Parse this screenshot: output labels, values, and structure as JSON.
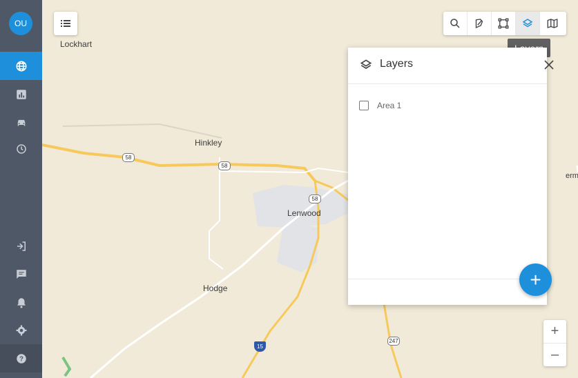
{
  "user": {
    "initials": "OU"
  },
  "sidebar": {
    "top_items": [
      {
        "icon": "globe-icon",
        "active": true
      },
      {
        "icon": "chart-icon",
        "active": false
      },
      {
        "icon": "car-icon",
        "active": false
      },
      {
        "icon": "clock-icon",
        "active": false
      }
    ],
    "bottom_items": [
      {
        "icon": "logout-icon"
      },
      {
        "icon": "chat-icon"
      },
      {
        "icon": "bell-icon"
      },
      {
        "icon": "gear-icon"
      },
      {
        "icon": "help-icon"
      }
    ]
  },
  "map": {
    "towns": [
      "Lockhart",
      "Hinkley",
      "Lenwood",
      "Hodge"
    ],
    "route_shields": [
      "58",
      "58",
      "58",
      "15",
      "247"
    ],
    "edge_label": "erm"
  },
  "toolbar": {
    "tools": [
      "search-icon",
      "draw-polygon-icon",
      "select-area-icon",
      "layers-icon",
      "map-icon"
    ],
    "tooltip": "Layers"
  },
  "layers_panel": {
    "title": "Layers",
    "items": [
      {
        "label": "Area 1",
        "checked": false
      }
    ],
    "add_label": "+"
  },
  "zoom": {
    "in_label": "+",
    "out_label": "–"
  },
  "colors": {
    "accent": "#1e90db",
    "sidebar": "#4e5866",
    "map_bg": "#f1ead9",
    "road": "#f7c85a"
  }
}
